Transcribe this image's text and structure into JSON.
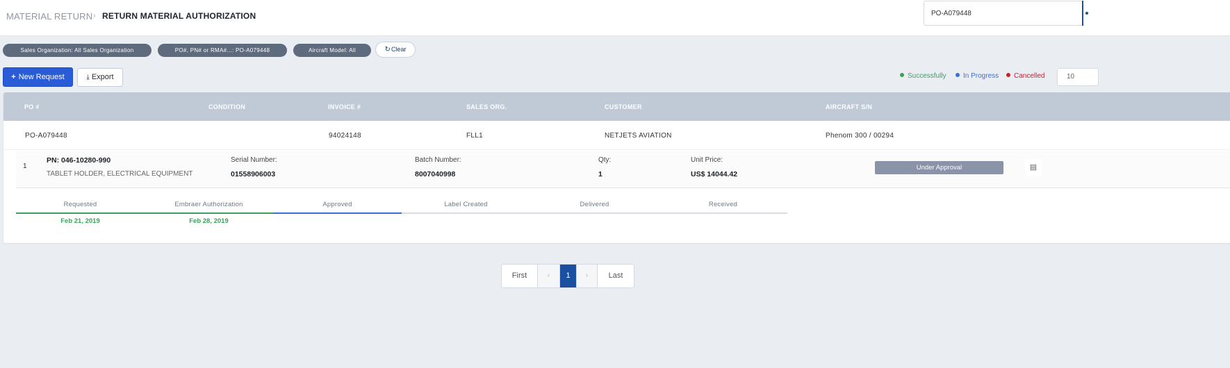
{
  "breadcrumb": {
    "parent": "MATERIAL RETURN",
    "separator": "›",
    "current": "RETURN MATERIAL AUTHORIZATION"
  },
  "search": {
    "value": "PO-A079448"
  },
  "filters": {
    "chips": [
      "Sales Organization: All Sales Organization",
      "PO#, PN# or RMA#...: PO-A079448",
      "Aircraft Model: All"
    ],
    "clear_icon": "↻",
    "clear_label": "Clear"
  },
  "actions": {
    "new_icon": "+",
    "new_label": "New Request",
    "export_icon": "⤓",
    "export_label": "Export"
  },
  "legend": [
    {
      "label": "Successfully",
      "color": "#3aa35b"
    },
    {
      "label": "In Progress",
      "color": "#3d6fd6"
    },
    {
      "label": "Cancelled",
      "color": "#c8202f"
    }
  ],
  "page_size": "10",
  "table": {
    "headers": [
      "PO #",
      "CONDITION",
      "INVOICE #",
      "SALES ORG.",
      "CUSTOMER",
      "AIRCRAFT S/N"
    ],
    "row": {
      "po": "PO-A079448",
      "condition": "",
      "invoice": "94024148",
      "sales_org": "FLL1",
      "customer": "NETJETS AVIATION",
      "aircraft_sn": "Phenom 300 / 00294"
    },
    "item": {
      "index": "1",
      "pn": "PN: 046-10280-990",
      "description": "TABLET HOLDER, ELECTRICAL EQUIPMENT",
      "serial_label": "Serial Number:",
      "serial_value": "01558906003",
      "batch_label": "Batch Number:",
      "batch_value": "8007040998",
      "qty_label": "Qty:",
      "qty_value": "1",
      "price_label": "Unit Price:",
      "price_value": "US$ 14044.42",
      "status": "Under Approval",
      "doc_icon": "▤"
    }
  },
  "tracker": {
    "steps": [
      {
        "label": "Requested",
        "date": "Feb 21, 2019",
        "state": "done"
      },
      {
        "label": "Embraer Authorization",
        "date": "Feb 28, 2019",
        "state": "done"
      },
      {
        "label": "Approved",
        "date": "",
        "state": "current"
      },
      {
        "label": "Label Created",
        "date": "",
        "state": "pending"
      },
      {
        "label": "Delivered",
        "date": "",
        "state": "pending"
      },
      {
        "label": "Received",
        "date": "",
        "state": "pending"
      }
    ],
    "colors": {
      "done": "#3aa35b",
      "current": "#3d6fd6",
      "pending": "#d8dde3"
    }
  },
  "pagination": {
    "first": "First",
    "prev": "‹",
    "current": "1",
    "next": "›",
    "last": "Last"
  }
}
